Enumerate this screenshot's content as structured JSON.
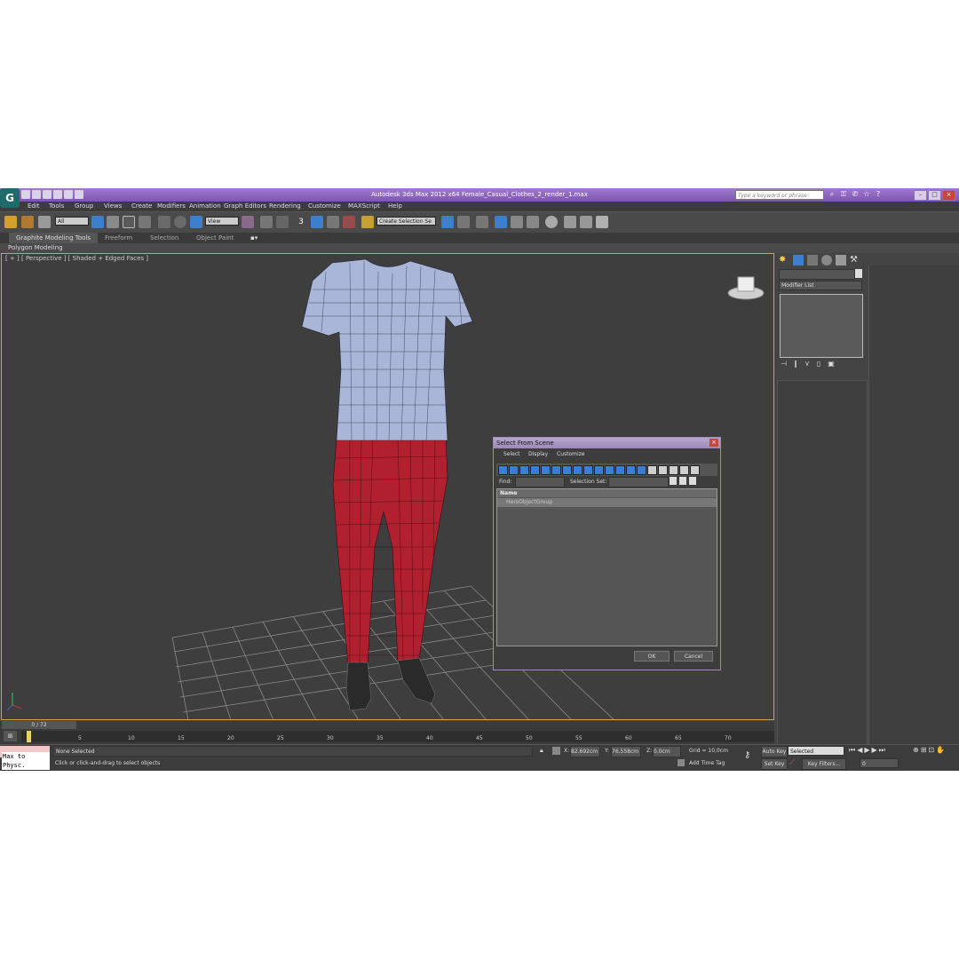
{
  "window": {
    "title": "Autodesk 3ds Max  2012 x64     Female_Casual_Clothes_2_render_1.max",
    "search_placeholder": "Type a keyword or phrase"
  },
  "menu": [
    "Edit",
    "Tools",
    "Group",
    "Views",
    "Create",
    "Modifiers",
    "Animation",
    "Graph Editors",
    "Rendering",
    "Customize",
    "MAXScript",
    "Help"
  ],
  "toolbar": {
    "filter_value": "All",
    "ref_coord_value": "View",
    "selection_set_value": "Create Selection Se",
    "snap_label": "3"
  },
  "ribbon": {
    "tabs": [
      "Graphite Modeling Tools",
      "Freeform",
      "Selection",
      "Object Paint"
    ],
    "sub_label": "Polygon Modeling"
  },
  "viewport": {
    "label": "[ + ] [ Perspective ] [ Shaded + Edged Faces ]"
  },
  "command_panel": {
    "modifier_list_label": "Modifier List"
  },
  "dialog": {
    "title": "Select From Scene",
    "menu": [
      "Select",
      "Display",
      "Customize"
    ],
    "find_label": "Find:",
    "selection_set_label": "Selection Set:",
    "column_header": "Name",
    "row_item": "HeroObjectGroup",
    "ok_label": "OK",
    "cancel_label": "Cancel"
  },
  "timeline": {
    "frame_counter": "0 / 72",
    "ticks": [
      "0",
      "5",
      "10",
      "15",
      "20",
      "25",
      "30",
      "35",
      "40",
      "45",
      "50",
      "55",
      "60",
      "65",
      "70"
    ]
  },
  "status": {
    "maxscript_label": "Max to Physc.",
    "selection_status": "None Selected",
    "prompt": "Click or click-and-drag to select objects",
    "x_label": "X:",
    "x_value": "82,692cm",
    "y_label": "Y:",
    "y_value": "76,558cm",
    "z_label": "Z:",
    "z_value": "0,0cm",
    "grid": "Grid = 10,0cm",
    "add_time_tag": "Add Time Tag",
    "auto_key": "Auto Key",
    "set_key": "Set Key",
    "key_mode_value": "Selected",
    "key_filters": "Key Filters...",
    "frame_value": "0"
  },
  "colors": {
    "title_bar": "#8a63bd",
    "viewport_bg": "#3e3e3e",
    "shirt": "#a9b6d8",
    "pants": "#b0202e",
    "active_border": "#c8a84a"
  }
}
